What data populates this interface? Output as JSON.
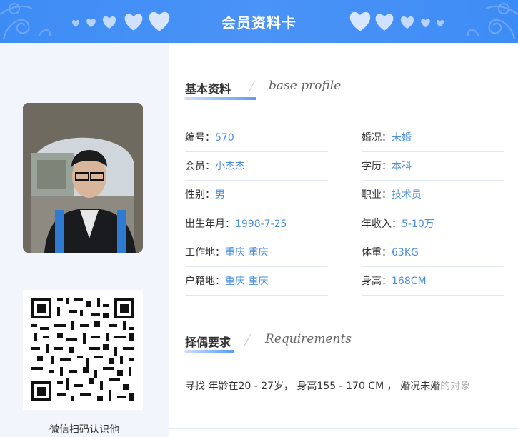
{
  "header": {
    "title": "会员资料卡"
  },
  "basic": {
    "title": "基本资料",
    "subtitle": "base profile",
    "left_rows": [
      {
        "label": "编号：",
        "value": "570"
      },
      {
        "label": "会员：",
        "value": "小杰杰"
      },
      {
        "label": "性别：",
        "value": "男"
      },
      {
        "label": "出生年月：",
        "value": "1998-7-25"
      },
      {
        "label": "工作地：",
        "value": "重庆 重庆"
      },
      {
        "label": "户籍地：",
        "value": "重庆 重庆"
      }
    ],
    "right_rows": [
      {
        "label": "婚况：",
        "value": "未婚"
      },
      {
        "label": "学历：",
        "value": "本科"
      },
      {
        "label": "职业：",
        "value": "技术员"
      },
      {
        "label": "年收入：",
        "value": "5-10万"
      },
      {
        "label": "体重：",
        "value": "63KG"
      },
      {
        "label": "身高：",
        "value": "168CM"
      }
    ]
  },
  "requirements": {
    "title": "择偶要求",
    "subtitle": "Requirements",
    "text": "寻找 年龄在20 - 27岁， 身高155 - 170 CM ， 婚况未婚",
    "text_faded": "的对象"
  },
  "qr": {
    "caption": "微信扫码认识他"
  },
  "colors": {
    "header": "#3d8cf5",
    "value": "#4a8fdc",
    "accent_line": "#5a9bf6",
    "left_bg": "#f2f6fc"
  }
}
